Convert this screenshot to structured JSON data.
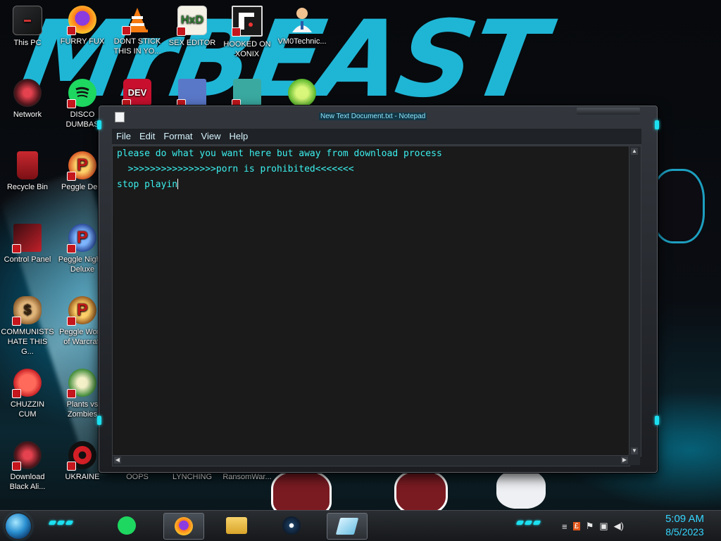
{
  "desktop": {
    "icons": [
      {
        "label": "This PC"
      },
      {
        "label": "FURRY FUX"
      },
      {
        "label": "DONT STICK THIS IN YO..."
      },
      {
        "label": "SEX EDITOR"
      },
      {
        "label": "HOOKED ON XONIX"
      },
      {
        "label": "VM0Technic..."
      },
      {
        "label": "Network"
      },
      {
        "label": "DISCO DUMBAS"
      },
      {
        "label": ""
      },
      {
        "label": ""
      },
      {
        "label": ""
      },
      {
        "label": ""
      },
      {
        "label": "Recycle Bin"
      },
      {
        "label": "Peggle Delu"
      },
      {
        "label": "Control Panel"
      },
      {
        "label": "Peggle Nights Deluxe"
      },
      {
        "label": "COMMUNISTS HATE THIS G..."
      },
      {
        "label": "Peggle World of Warcraft"
      },
      {
        "label": "CHUZZIN CUM"
      },
      {
        "label": "Plants vs Zombies"
      },
      {
        "label": "Download Black Ali..."
      },
      {
        "label": "UKRAINE"
      },
      {
        "label": "OOPS"
      },
      {
        "label": "LYNCHING"
      },
      {
        "label": "RansomWar..."
      }
    ],
    "wallpaper_text": "MrBEAST"
  },
  "notepad": {
    "title": "New Text Document.txt - Notepad",
    "menu": [
      "File",
      "Edit",
      "Format",
      "View",
      "Help"
    ],
    "content_lines": [
      "please do what you want here but away from download process",
      "  >>>>>>>>>>>>>>>>porn is prohibited<<<<<<<",
      "stop playin"
    ]
  },
  "taskbar": {
    "apps": [
      {
        "icon": "spotify-icon",
        "active": false
      },
      {
        "icon": "firefox-icon",
        "active": true
      },
      {
        "icon": "file-explorer-icon",
        "active": false
      },
      {
        "icon": "steam-icon",
        "active": false
      },
      {
        "icon": "notepad-icon",
        "active": true
      }
    ],
    "clock": {
      "time": "5:09 AM",
      "date": "8/5/2023"
    },
    "tray_icons": [
      "show-desktop-icon",
      "language-icon",
      "flag-icon",
      "network-icon",
      "volume-icon"
    ]
  },
  "colors": {
    "accent_cyan": "#1ce0f0",
    "editor_text": "#3cf0ee",
    "wallpaper_text": "#1fb6d6",
    "clock_text": "#35d6ff"
  }
}
